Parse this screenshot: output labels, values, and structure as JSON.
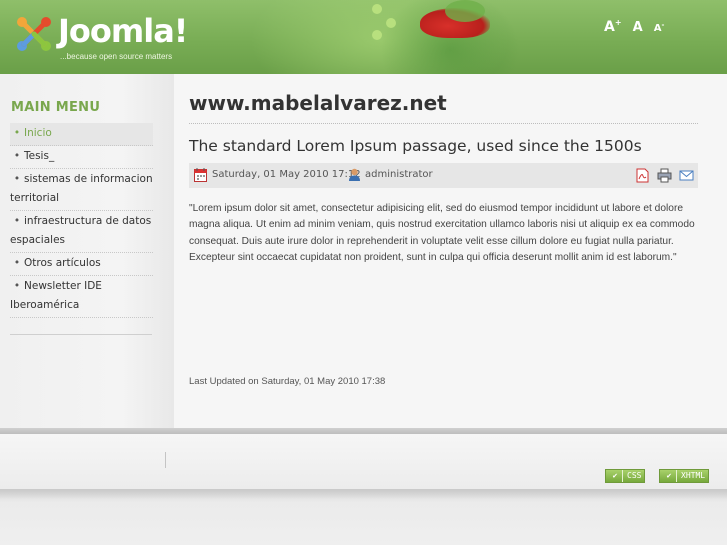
{
  "header": {
    "logo_text": "Joomla!",
    "logo_tagline": "...because open source matters",
    "font_controls": {
      "increase": "A",
      "increase_sup": "+",
      "reset": "A",
      "decrease": "A",
      "decrease_sup": "-"
    }
  },
  "sidebar": {
    "menu_title": "MAIN MENU",
    "items": [
      {
        "label": "Inicio",
        "active": true
      },
      {
        "label": "Tesis_",
        "active": false
      },
      {
        "label": "sistemas de informacion territorial",
        "active": false
      },
      {
        "label": "infraestructura de datos espaciales",
        "active": false
      },
      {
        "label": "Otros artículos",
        "active": false
      },
      {
        "label": "Newsletter IDE Iberoamérica",
        "active": false
      }
    ]
  },
  "main": {
    "site_heading": "www.mabelalvarez.net",
    "article": {
      "title": "The standard Lorem Ipsum passage, used since the 1500s",
      "date": "Saturday, 01 May 2010 17:12",
      "author": "administrator",
      "tools": [
        "pdf-icon",
        "print-icon",
        "email-icon"
      ],
      "body": "\"Lorem ipsum dolor sit amet, consectetur adipisicing elit, sed do eiusmod tempor incididunt ut labore et dolore magna aliqua. Ut enim ad minim veniam, quis nostrud exercitation ullamco laboris nisi ut aliquip ex ea commodo consequat. Duis aute irure dolor in reprehenderit in voluptate velit esse cillum dolore eu fugiat nulla pariatur. Excepteur sint occaecat cupidatat non proident, sunt in culpa qui officia deserunt mollit anim id est laborum.\"",
      "last_updated": "Last Updated on Saturday, 01 May 2010 17:38"
    }
  },
  "footer": {
    "badges": [
      {
        "check": "✔",
        "label": "CSS"
      },
      {
        "check": "✔",
        "label": "XHTML"
      }
    ]
  },
  "colors": {
    "accent_green": "#79a74d",
    "header_green": "#79ad55",
    "badge_green": "#77a93c"
  }
}
